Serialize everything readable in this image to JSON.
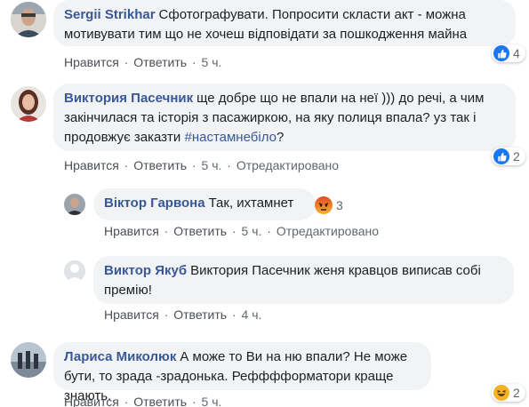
{
  "comments": [
    {
      "author": "Sergii Strikhar",
      "text": "Сфотографувати. Попросити скласти акт - можна мотивувати тим що не хочеш відповідати за пошкодження майна",
      "like": "Нравится",
      "reply": "Ответить",
      "time": "5 ч.",
      "reaction_count": "4",
      "reaction_icon": "like-icon",
      "colors": {
        "reaction": "#1877f2"
      }
    },
    {
      "author": "Виктория Пасечник",
      "text_before_tag": "ще добре що не впали на неї ))) до речі, а чим закінчилася та історія з пасажиркою, на яку полиця впала? уз так і продовжує заказти ",
      "hashtag": "#настамнебіло",
      "text_after_tag": "?",
      "like": "Нравится",
      "reply": "Ответить",
      "time": "5 ч.",
      "edited": "Отредактировано",
      "reaction_count": "2",
      "reaction_icon": "like-icon"
    },
    {
      "author": "Віктор Гарвона",
      "text": "Так, ихтамнет",
      "like": "Нравится",
      "reply": "Ответить",
      "time": "5 ч.",
      "edited": "Отредактировано",
      "reaction_count": "3",
      "reaction_icon": "angry-icon",
      "colors": {
        "reaction": "#e9710f"
      }
    },
    {
      "author": "Виктор Якуб",
      "text": "Виктория Пасечник женя кравцов виписав собі премію!",
      "like": "Нравится",
      "reply": "Ответить",
      "time": "4 ч."
    },
    {
      "author": "Лариса Миколюк",
      "text": "А може то Ви на ню впали? Не може бути, то зрада -зрадонька. Рефффформатори краще знають.",
      "like": "Нравится",
      "reply": "Ответить",
      "time": "5 ч.",
      "reaction_count": "2",
      "reaction_icon": "haha-icon",
      "colors": {
        "reaction": "#f7b125"
      }
    }
  ],
  "separator": "·"
}
